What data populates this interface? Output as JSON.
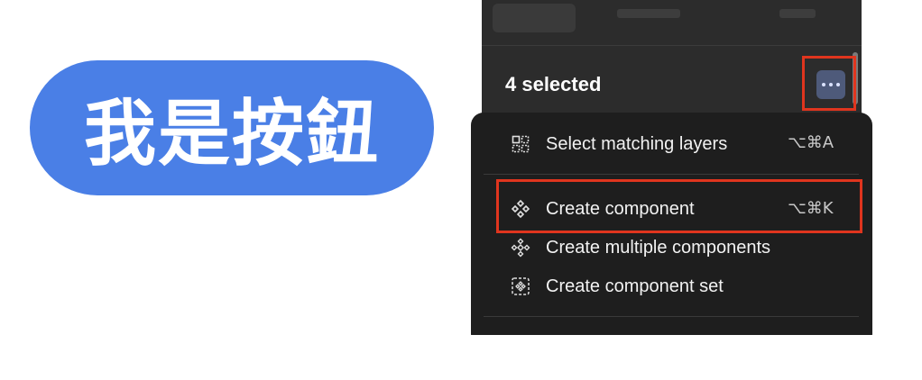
{
  "big_button": {
    "label": "我是按鈕",
    "color": "#4a7fe6"
  },
  "panel": {
    "selection_label": "4 selected",
    "more_icon": "ellipsis-icon"
  },
  "menu": {
    "items": [
      {
        "label": "Select matching layers",
        "shortcut": "⌥⌘A",
        "icon": "select-matching-icon"
      },
      {
        "label": "Create component",
        "shortcut": "⌥⌘K",
        "icon": "component-icon"
      },
      {
        "label": "Create multiple components",
        "shortcut": "",
        "icon": "multiple-components-icon"
      },
      {
        "label": "Create component set",
        "shortcut": "",
        "icon": "component-set-icon"
      }
    ]
  },
  "colors": {
    "highlight": "#e0351e",
    "panel_bg": "#2c2c2c",
    "menu_bg": "#1e1e1e"
  }
}
